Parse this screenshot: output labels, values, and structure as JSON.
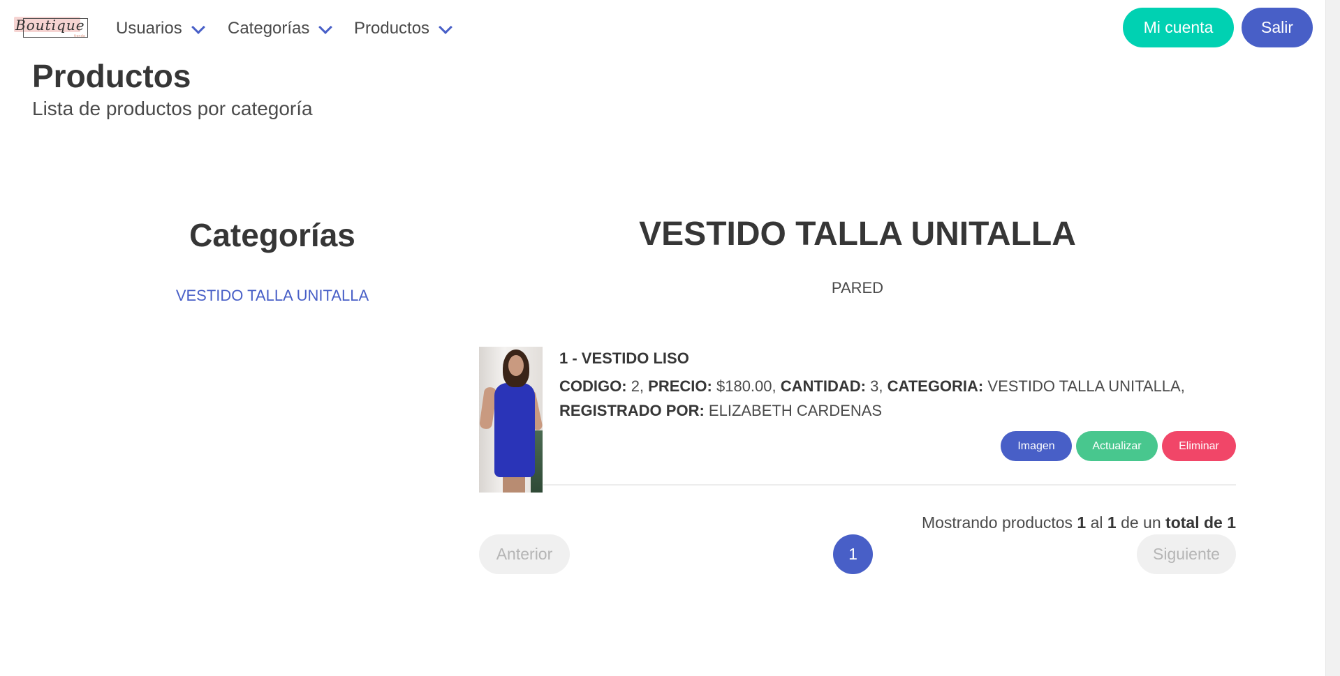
{
  "nav": {
    "logo_text": "Boutique",
    "logo_sub": "tienda",
    "menu": [
      {
        "label": "Usuarios"
      },
      {
        "label": "Categorías"
      },
      {
        "label": "Productos"
      }
    ],
    "account_label": "Mi cuenta",
    "exit_label": "Salir",
    "colors": {
      "account": "#00d1b2",
      "exit": "#485fc7",
      "chevron": "#485fc7"
    }
  },
  "header": {
    "title": "Productos",
    "subtitle": "Lista de productos por categoría"
  },
  "categories": {
    "title": "Categorías",
    "items": [
      {
        "label": "VESTIDO TALLA UNITALLA"
      }
    ]
  },
  "main": {
    "category_title": "VESTIDO TALLA UNITALLA",
    "category_description": "PARED",
    "products": [
      {
        "name": "1 - VESTIDO LISO",
        "code_label": "CODIGO:",
        "code": "2,",
        "price_label": "PRECIO:",
        "price": "$180.00,",
        "qty_label": "CANTIDAD:",
        "qty": "3,",
        "category_label": "CATEGORIA:",
        "category": "VESTIDO TALLA UNITALLA,",
        "registered_label": "REGISTRADO POR:",
        "registered_by": "ELIZABETH CARDENAS",
        "image_icon": "product-photo",
        "buttons": {
          "image": "Imagen",
          "update": "Actualizar",
          "delete": "Eliminar"
        }
      }
    ],
    "summary": {
      "prefix": "Mostrando productos",
      "from": "1",
      "al": "al",
      "to": "1",
      "de_un": "de un",
      "total_label": "total de 1"
    },
    "pagination": {
      "prev": "Anterior",
      "current": "1",
      "next": "Siguiente"
    }
  }
}
